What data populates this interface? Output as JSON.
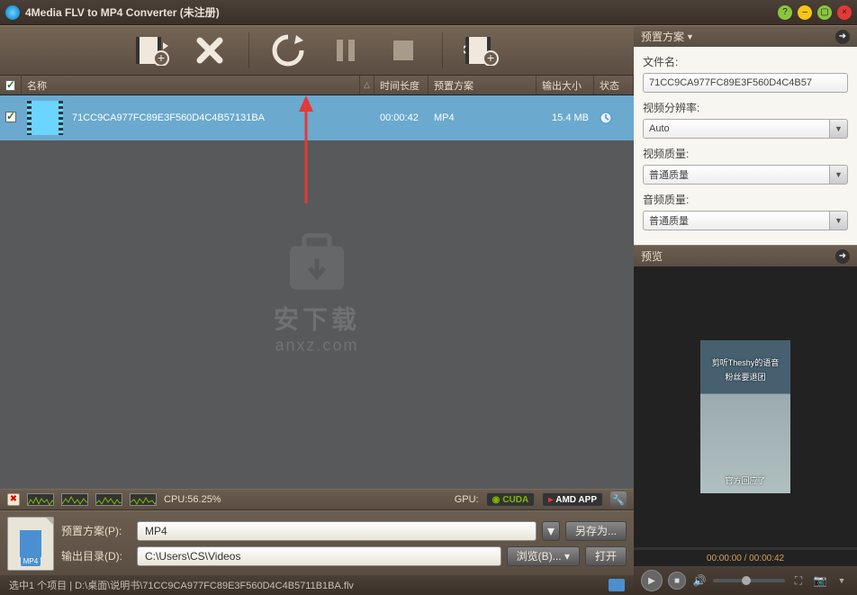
{
  "titlebar": {
    "text": "4Media FLV to MP4 Converter (未注册)"
  },
  "listhead": {
    "name": "名称",
    "time": "时间长度",
    "preset": "预置方案",
    "size": "输出大小",
    "status": "状态"
  },
  "row": {
    "filename": "71CC9CA977FC89E3F560D4C4B57131BA",
    "duration": "00:00:42",
    "preset": "MP4",
    "size": "15.4 MB"
  },
  "watermark": {
    "cn": "安下载",
    "en": "anxz.com"
  },
  "perf": {
    "cpu_label": "CPU:56.25%",
    "gpu_label": "GPU:",
    "cuda": "CUDA",
    "amd": "AMD APP"
  },
  "bottom": {
    "preset_label": "预置方案(P):",
    "preset_value": "MP4",
    "saveas": "另存为...",
    "output_label": "输出目录(D):",
    "output_value": "C:\\Users\\CS\\Videos",
    "browse": "浏览(B)...",
    "open": "打开"
  },
  "statusbar": {
    "text": "选中1 个项目 | D:\\桌面\\说明书\\71CC9CA977FC89E3F560D4C4B5711B1BA.flv"
  },
  "rightpanel": {
    "preset_head": "预置方案",
    "filename_label": "文件名:",
    "filename_value": "71CC9CA977FC89E3F560D4C4B57",
    "resolution_label": "视频分辨率:",
    "resolution_value": "Auto",
    "vquality_label": "视频质量:",
    "vquality_value": "普通质量",
    "aquality_label": "音频质量:",
    "aquality_value": "普通质量",
    "preview_head": "预览",
    "preview_time": "00:00:00 / 00:00:42",
    "ptxt1": "剪听Theshy的语音",
    "ptxt2": "粉丝要退团",
    "ptxt3": "官方回应了"
  }
}
